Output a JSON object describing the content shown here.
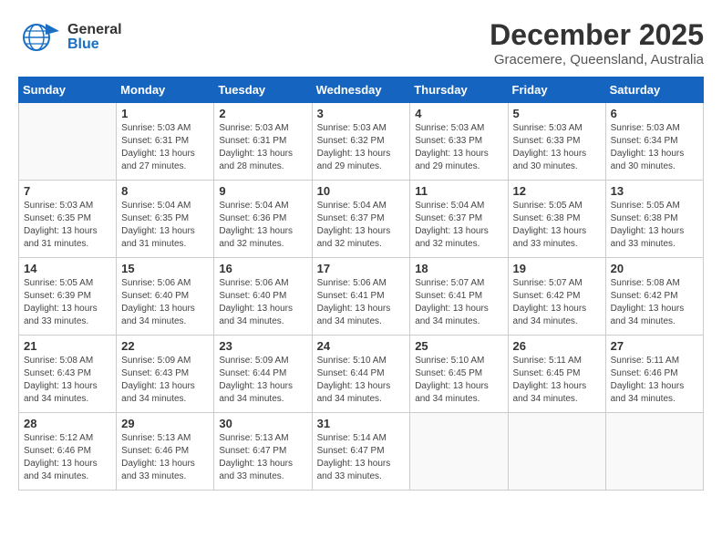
{
  "header": {
    "logo_general": "General",
    "logo_blue": "Blue",
    "month_year": "December 2025",
    "location": "Gracemere, Queensland, Australia"
  },
  "weekdays": [
    "Sunday",
    "Monday",
    "Tuesday",
    "Wednesday",
    "Thursday",
    "Friday",
    "Saturday"
  ],
  "weeks": [
    [
      {
        "day": "",
        "info": ""
      },
      {
        "day": "1",
        "info": "Sunrise: 5:03 AM\nSunset: 6:31 PM\nDaylight: 13 hours\nand 27 minutes."
      },
      {
        "day": "2",
        "info": "Sunrise: 5:03 AM\nSunset: 6:31 PM\nDaylight: 13 hours\nand 28 minutes."
      },
      {
        "day": "3",
        "info": "Sunrise: 5:03 AM\nSunset: 6:32 PM\nDaylight: 13 hours\nand 29 minutes."
      },
      {
        "day": "4",
        "info": "Sunrise: 5:03 AM\nSunset: 6:33 PM\nDaylight: 13 hours\nand 29 minutes."
      },
      {
        "day": "5",
        "info": "Sunrise: 5:03 AM\nSunset: 6:33 PM\nDaylight: 13 hours\nand 30 minutes."
      },
      {
        "day": "6",
        "info": "Sunrise: 5:03 AM\nSunset: 6:34 PM\nDaylight: 13 hours\nand 30 minutes."
      }
    ],
    [
      {
        "day": "7",
        "info": "Sunrise: 5:03 AM\nSunset: 6:35 PM\nDaylight: 13 hours\nand 31 minutes."
      },
      {
        "day": "8",
        "info": "Sunrise: 5:04 AM\nSunset: 6:35 PM\nDaylight: 13 hours\nand 31 minutes."
      },
      {
        "day": "9",
        "info": "Sunrise: 5:04 AM\nSunset: 6:36 PM\nDaylight: 13 hours\nand 32 minutes."
      },
      {
        "day": "10",
        "info": "Sunrise: 5:04 AM\nSunset: 6:37 PM\nDaylight: 13 hours\nand 32 minutes."
      },
      {
        "day": "11",
        "info": "Sunrise: 5:04 AM\nSunset: 6:37 PM\nDaylight: 13 hours\nand 32 minutes."
      },
      {
        "day": "12",
        "info": "Sunrise: 5:05 AM\nSunset: 6:38 PM\nDaylight: 13 hours\nand 33 minutes."
      },
      {
        "day": "13",
        "info": "Sunrise: 5:05 AM\nSunset: 6:38 PM\nDaylight: 13 hours\nand 33 minutes."
      }
    ],
    [
      {
        "day": "14",
        "info": "Sunrise: 5:05 AM\nSunset: 6:39 PM\nDaylight: 13 hours\nand 33 minutes."
      },
      {
        "day": "15",
        "info": "Sunrise: 5:06 AM\nSunset: 6:40 PM\nDaylight: 13 hours\nand 34 minutes."
      },
      {
        "day": "16",
        "info": "Sunrise: 5:06 AM\nSunset: 6:40 PM\nDaylight: 13 hours\nand 34 minutes."
      },
      {
        "day": "17",
        "info": "Sunrise: 5:06 AM\nSunset: 6:41 PM\nDaylight: 13 hours\nand 34 minutes."
      },
      {
        "day": "18",
        "info": "Sunrise: 5:07 AM\nSunset: 6:41 PM\nDaylight: 13 hours\nand 34 minutes."
      },
      {
        "day": "19",
        "info": "Sunrise: 5:07 AM\nSunset: 6:42 PM\nDaylight: 13 hours\nand 34 minutes."
      },
      {
        "day": "20",
        "info": "Sunrise: 5:08 AM\nSunset: 6:42 PM\nDaylight: 13 hours\nand 34 minutes."
      }
    ],
    [
      {
        "day": "21",
        "info": "Sunrise: 5:08 AM\nSunset: 6:43 PM\nDaylight: 13 hours\nand 34 minutes."
      },
      {
        "day": "22",
        "info": "Sunrise: 5:09 AM\nSunset: 6:43 PM\nDaylight: 13 hours\nand 34 minutes."
      },
      {
        "day": "23",
        "info": "Sunrise: 5:09 AM\nSunset: 6:44 PM\nDaylight: 13 hours\nand 34 minutes."
      },
      {
        "day": "24",
        "info": "Sunrise: 5:10 AM\nSunset: 6:44 PM\nDaylight: 13 hours\nand 34 minutes."
      },
      {
        "day": "25",
        "info": "Sunrise: 5:10 AM\nSunset: 6:45 PM\nDaylight: 13 hours\nand 34 minutes."
      },
      {
        "day": "26",
        "info": "Sunrise: 5:11 AM\nSunset: 6:45 PM\nDaylight: 13 hours\nand 34 minutes."
      },
      {
        "day": "27",
        "info": "Sunrise: 5:11 AM\nSunset: 6:46 PM\nDaylight: 13 hours\nand 34 minutes."
      }
    ],
    [
      {
        "day": "28",
        "info": "Sunrise: 5:12 AM\nSunset: 6:46 PM\nDaylight: 13 hours\nand 34 minutes."
      },
      {
        "day": "29",
        "info": "Sunrise: 5:13 AM\nSunset: 6:46 PM\nDaylight: 13 hours\nand 33 minutes."
      },
      {
        "day": "30",
        "info": "Sunrise: 5:13 AM\nSunset: 6:47 PM\nDaylight: 13 hours\nand 33 minutes."
      },
      {
        "day": "31",
        "info": "Sunrise: 5:14 AM\nSunset: 6:47 PM\nDaylight: 13 hours\nand 33 minutes."
      },
      {
        "day": "",
        "info": ""
      },
      {
        "day": "",
        "info": ""
      },
      {
        "day": "",
        "info": ""
      }
    ]
  ]
}
